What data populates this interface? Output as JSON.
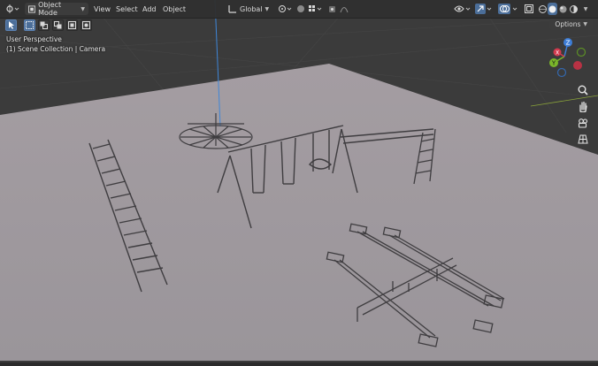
{
  "header": {
    "mode_label": "Object Mode",
    "menus": [
      "View",
      "Select",
      "Add",
      "Object"
    ],
    "orientation_label": "Global"
  },
  "overlay": {
    "view_name": "User Perspective",
    "collection_label": "(1) Scene Collection | Camera"
  },
  "options_label": "Options",
  "gizmo": {
    "z_label": "Z",
    "y_label": "Y",
    "x_label": "X",
    "colors": {
      "x": "#d23a4e",
      "y": "#7ab62a",
      "z": "#3d7dd6"
    }
  },
  "icons": [
    "editor-type-icon",
    "object-mode-icon",
    "select-box-icon",
    "transform-orientation-icon",
    "pivot-icon",
    "snap-icon",
    "proportional-edit-icon",
    "visibility-icon",
    "gizmo-icon",
    "overlay-icon",
    "xray-icon",
    "shading-wire-icon",
    "shading-solid-icon",
    "shading-material-icon",
    "shading-rendered-icon",
    "zoom-icon",
    "hand-pan-icon",
    "camera-view-icon",
    "grid-view-icon"
  ],
  "colors": {
    "header_bg": "#303030",
    "floor": "#9e989d",
    "grid_bg": "#3d3d3d",
    "accent": "#4b6e99"
  }
}
